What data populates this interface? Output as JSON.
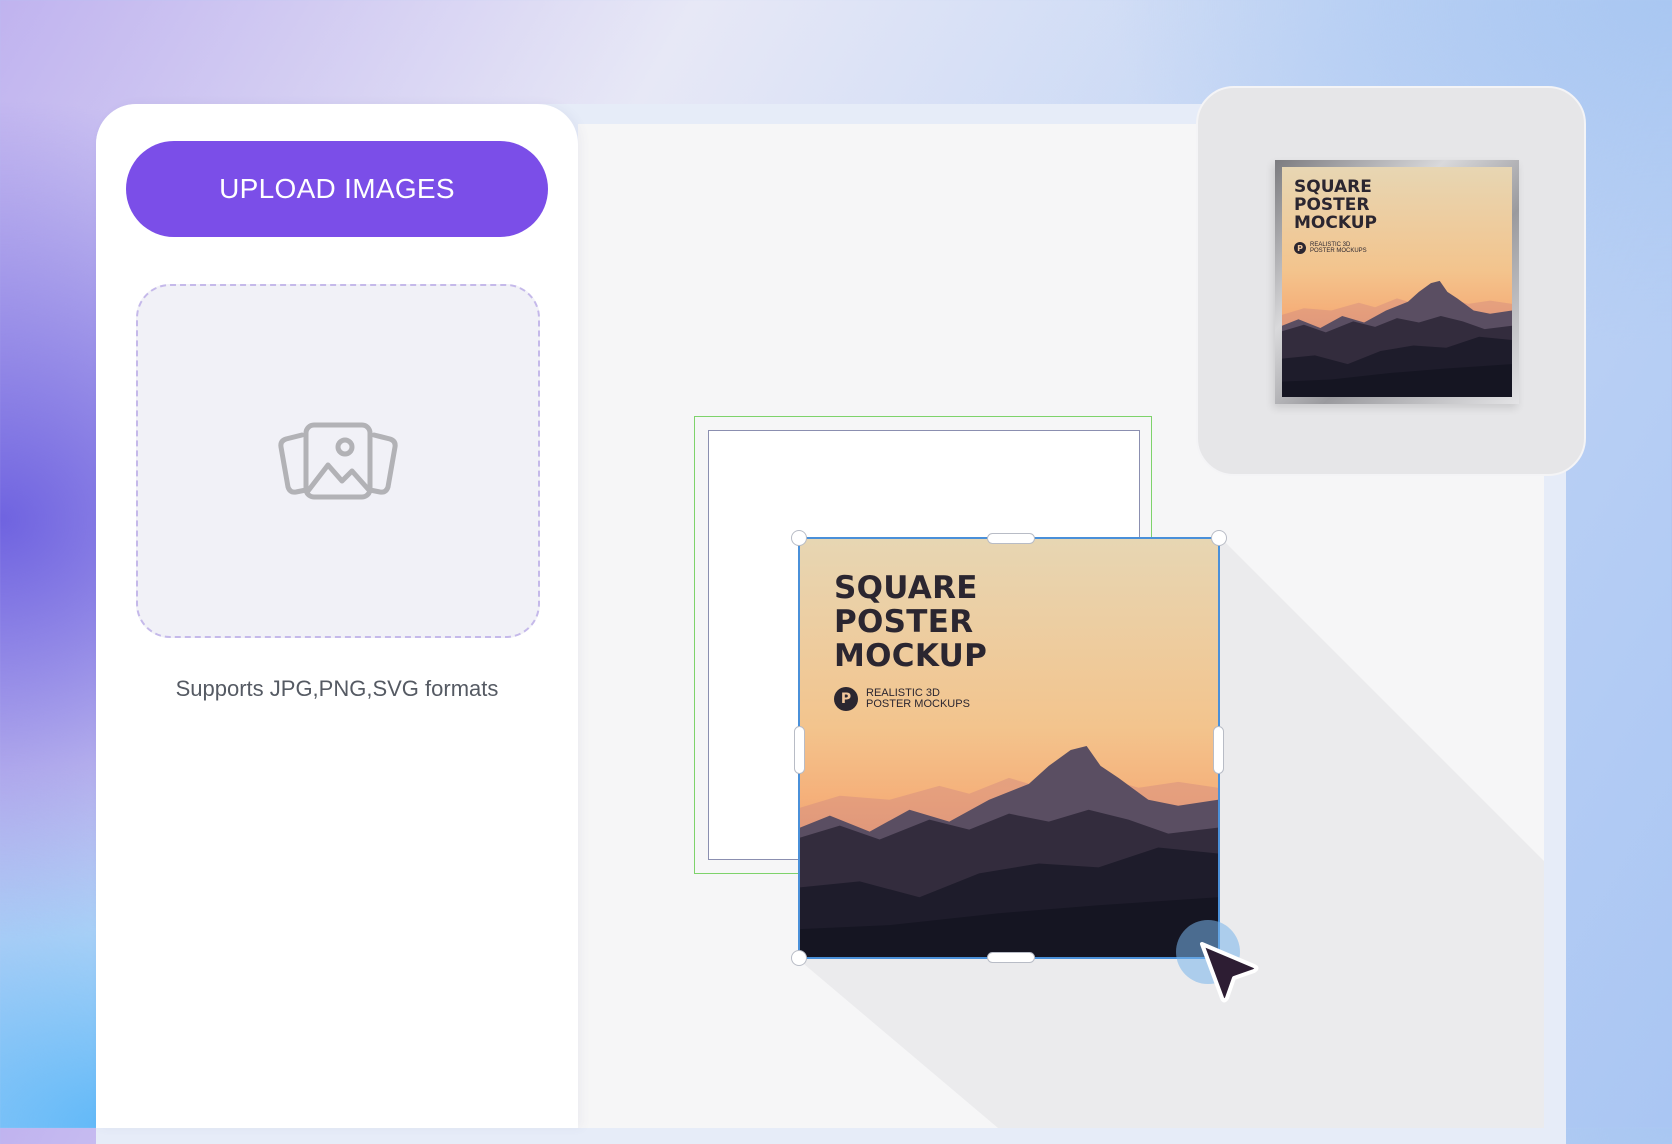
{
  "sidebar": {
    "upload_button_label": "UPLOAD IMAGES",
    "drop_zone_icon": "images-icon",
    "formats_note": "Supports JPG,PNG,SVG formats"
  },
  "editor": {
    "poster": {
      "title": "SQUARE\nPOSTER\nMOCKUP",
      "subtitle": "REALISTIC 3D\nPOSTER MOCKUPS",
      "logo_glyph": "P"
    }
  },
  "preview": {
    "title": "SQUARE\nPOSTER\nMOCKUP",
    "subtitle": "REALISTIC 3D\nPOSTER MOCKUPS",
    "logo_glyph": "P"
  },
  "colors": {
    "accent": "#7b4ee8",
    "selection": "#4a90d9",
    "placeholder_border": "#7ed36b",
    "cursor": "#2d1d33"
  }
}
